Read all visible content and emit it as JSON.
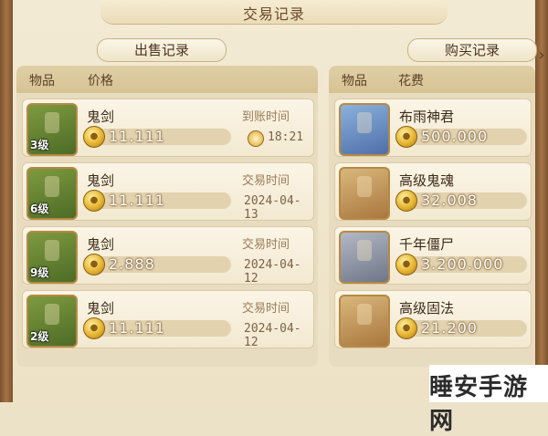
{
  "window": {
    "title": "交易记录"
  },
  "tabs": {
    "sell": "出售记录",
    "buy": "购买记录"
  },
  "sell_panel": {
    "col_item": "物品",
    "col_price": "价格",
    "rows": [
      {
        "level": "3级",
        "name": "鬼剑",
        "price": "11.111",
        "time_label": "到账时间",
        "time_value": "18:21",
        "icon": "ghost-sword-icon",
        "has_clock": true
      },
      {
        "level": "6级",
        "name": "鬼剑",
        "price": "11.111",
        "time_label": "交易时间",
        "time_value": "2024-04-13",
        "icon": "ghost-sword-icon",
        "has_clock": false
      },
      {
        "level": "9级",
        "name": "鬼剑",
        "price": "2.888",
        "time_label": "交易时间",
        "time_value": "2024-04-12",
        "icon": "ghost-sword-icon",
        "has_clock": false
      },
      {
        "level": "2级",
        "name": "鬼剑",
        "price": "11.111",
        "time_label": "交易时间",
        "time_value": "2024-04-12",
        "icon": "ghost-sword-icon",
        "has_clock": false
      }
    ]
  },
  "buy_panel": {
    "col_item": "物品",
    "col_cost": "花费",
    "rows": [
      {
        "name": "布雨神君",
        "price": "500.000",
        "icon": "rain-god-portrait-icon"
      },
      {
        "name": "高级鬼魂",
        "price": "32.008",
        "icon": "scroll-icon"
      },
      {
        "name": "千年僵尸",
        "price": "3.200.000",
        "icon": "zombie-portrait-icon"
      },
      {
        "name": "高级固法",
        "price": "21.200",
        "icon": "scroll-icon"
      }
    ]
  },
  "watermark": "睡安手游网",
  "colors": {
    "accent": "#e6b531",
    "panel": "#e8dcc0",
    "text": "#3c2a18"
  }
}
